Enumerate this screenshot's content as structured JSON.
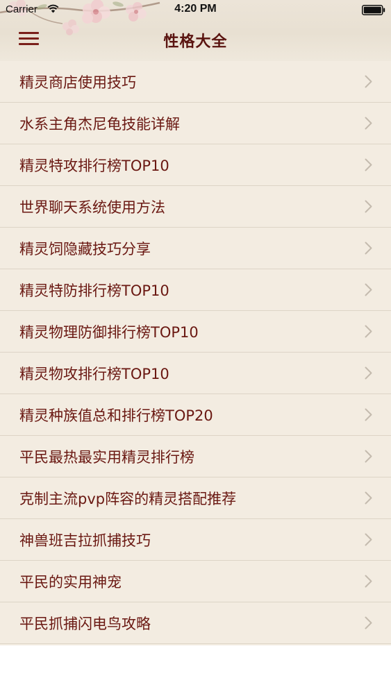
{
  "status_bar": {
    "carrier": "Carrier",
    "time": "4:20 PM"
  },
  "nav": {
    "title": "性格大全"
  },
  "list": {
    "items": [
      {
        "label": "精灵商店使用技巧"
      },
      {
        "label": "水系主角杰尼龟技能详解"
      },
      {
        "label": "精灵特攻排行榜TOP10"
      },
      {
        "label": "世界聊天系统使用方法"
      },
      {
        "label": "精灵饲隐藏技巧分享"
      },
      {
        "label": "精灵特防排行榜TOP10"
      },
      {
        "label": "精灵物理防御排行榜TOP10"
      },
      {
        "label": "精灵物攻排行榜TOP10"
      },
      {
        "label": "精灵种族值总和排行榜TOP20"
      },
      {
        "label": "平民最热最实用精灵排行榜"
      },
      {
        "label": "克制主流pvp阵容的精灵搭配推荐"
      },
      {
        "label": "神兽班吉拉抓捕技巧"
      },
      {
        "label": "平民的实用神宠"
      },
      {
        "label": "平民抓捕闪电鸟攻略"
      }
    ]
  },
  "colors": {
    "accent": "#6a1812",
    "list_background": "#f3ece1",
    "separator": "#ddd4c6"
  },
  "icons": {
    "menu": "hamburger-menu-icon",
    "row_chevron": "chevron-right-icon",
    "wifi": "wifi-icon",
    "battery": "battery-icon"
  }
}
